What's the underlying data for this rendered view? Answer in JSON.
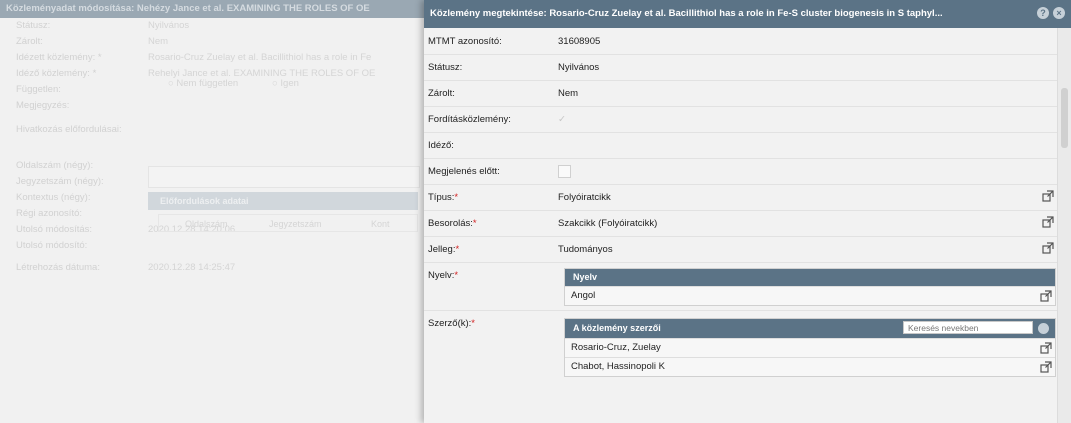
{
  "background_dialog": {
    "title": "Közleményadat módosítása: Nehézy Jance et al. EXAMINING THE ROLES OF OE",
    "rows": [
      {
        "label": "Státusz:",
        "value": "Nyilvános"
      },
      {
        "label": "Zárolt:",
        "value": "Nem"
      },
      {
        "label": "Idézett közlemény: *",
        "value": "Rosario-Cruz Zuelay et al. Bacillithiol has a role in Fe"
      },
      {
        "label": "Idéző közlemény: *",
        "value": "Rehelyi Jance et al. EXAMINING THE ROLES OF OE"
      },
      {
        "label": "Független:",
        "value": ""
      },
      {
        "label": "Megjegyzés:",
        "value": ""
      },
      {
        "label": "Hivatkozás előfordulásai:",
        "value": ""
      },
      {
        "label": "Oldalszám (négy):",
        "value": ""
      },
      {
        "label": "Jegyzetszám (négy):",
        "value": ""
      },
      {
        "label": "Kontextus (négy):",
        "value": ""
      },
      {
        "label": "Régi azonosító:",
        "value": ""
      },
      {
        "label": "Utolsó módosítás:",
        "value": "2020.12.28 14:20:06"
      },
      {
        "label": "Utolsó módosító:",
        "value": ""
      },
      {
        "label": "Létrehozás dátuma:",
        "value": "2020.12.28 14:25:47"
      }
    ],
    "radio_no": "Nem független",
    "radio_yes": "Igen",
    "occurrences_header": "Előfordulások adatai",
    "occurrences_cols": [
      "Oldalszám",
      "Jegyzetszám",
      "Kont"
    ]
  },
  "dialog": {
    "title": "Közlemény megtekintése: Rosario-Cruz Zuelay et al. Bacillithiol has a role in Fe-S cluster biogenesis in S taphyl...",
    "fields": {
      "mtmt_id": {
        "label": "MTMT azonosító:",
        "value": "31608905"
      },
      "status": {
        "label": "Státusz:",
        "value": "Nyilvános"
      },
      "locked": {
        "label": "Zárolt:",
        "value": "Nem"
      },
      "translation": {
        "label": "Fordításközlemény:"
      },
      "citing": {
        "label": "Idéző:"
      },
      "pre_publication": {
        "label": "Megjelenés előtt:"
      },
      "type": {
        "label": "Típus:",
        "req": "*",
        "value": "Folyóiratcikk"
      },
      "classification": {
        "label": "Besorolás:",
        "req": "*",
        "value": "Szakcikk (Folyóiratcikk)"
      },
      "character": {
        "label": "Jelleg:",
        "req": "*",
        "value": "Tudományos"
      },
      "language": {
        "label": "Nyelv:",
        "req": "*"
      },
      "authors": {
        "label": "Szerző(k):",
        "req": "*"
      }
    },
    "language_grid": {
      "header": "Nyelv",
      "rows": [
        "Angol"
      ]
    },
    "authors_grid": {
      "header": "A közlemény szerzői",
      "search_placeholder": "Keresés nevekben",
      "rows": [
        "Rosario-Cruz, Zuelay",
        "Chabot, Hassinopoli K"
      ]
    }
  },
  "colors": {
    "titlebar": "#5b7386",
    "required": "#d21f1f"
  }
}
